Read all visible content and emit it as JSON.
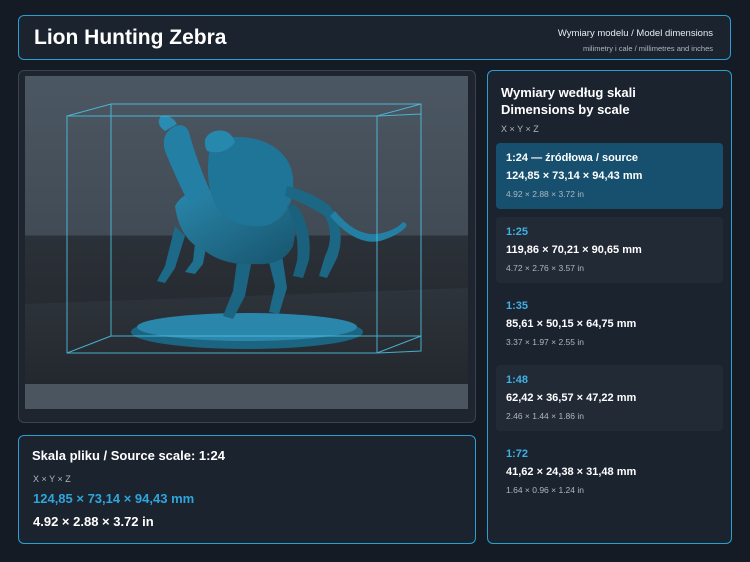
{
  "header": {
    "title": "Lion Hunting Zebra",
    "subtitle": "Wymiary modelu / Model dimensions",
    "subtitle2": "milimetry i cale / millimetres and inches"
  },
  "source": {
    "title": "Skala pliku / Source scale: 1:24",
    "axes": "X × Y × Z",
    "mm": "124,85 × 73,14 × 94,43 mm",
    "inches": "4.92 × 2.88 × 3.72 in"
  },
  "scales_panel": {
    "title_pl": "Wymiary według skali",
    "title_en": "Dimensions by scale",
    "axes": "X × Y × Z",
    "items": [
      {
        "label": "1:24  —  źródłowa / source",
        "mm": "124,85 × 73,14 × 94,43 mm",
        "inches": "4.92 × 2.88 × 3.72 in"
      },
      {
        "label": "1:25",
        "mm": "119,86 × 70,21 × 90,65 mm",
        "inches": "4.72 × 2.76 × 3.57 in"
      },
      {
        "label": "1:35",
        "mm": "85,61 × 50,15 × 64,75 mm",
        "inches": "3.37 × 1.97 × 2.55 in"
      },
      {
        "label": "1:48",
        "mm": "62,42 × 36,57 × 47,22 mm",
        "inches": "2.46 × 1.44 × 1.86 in"
      },
      {
        "label": "1:72",
        "mm": "41,62 × 24,38 × 31,48 mm",
        "inches": "1.64 × 0.96 × 1.24 in"
      }
    ]
  },
  "colors": {
    "accent": "#2a9fd2",
    "model": "#1f6f8f",
    "background": "#151b24"
  }
}
